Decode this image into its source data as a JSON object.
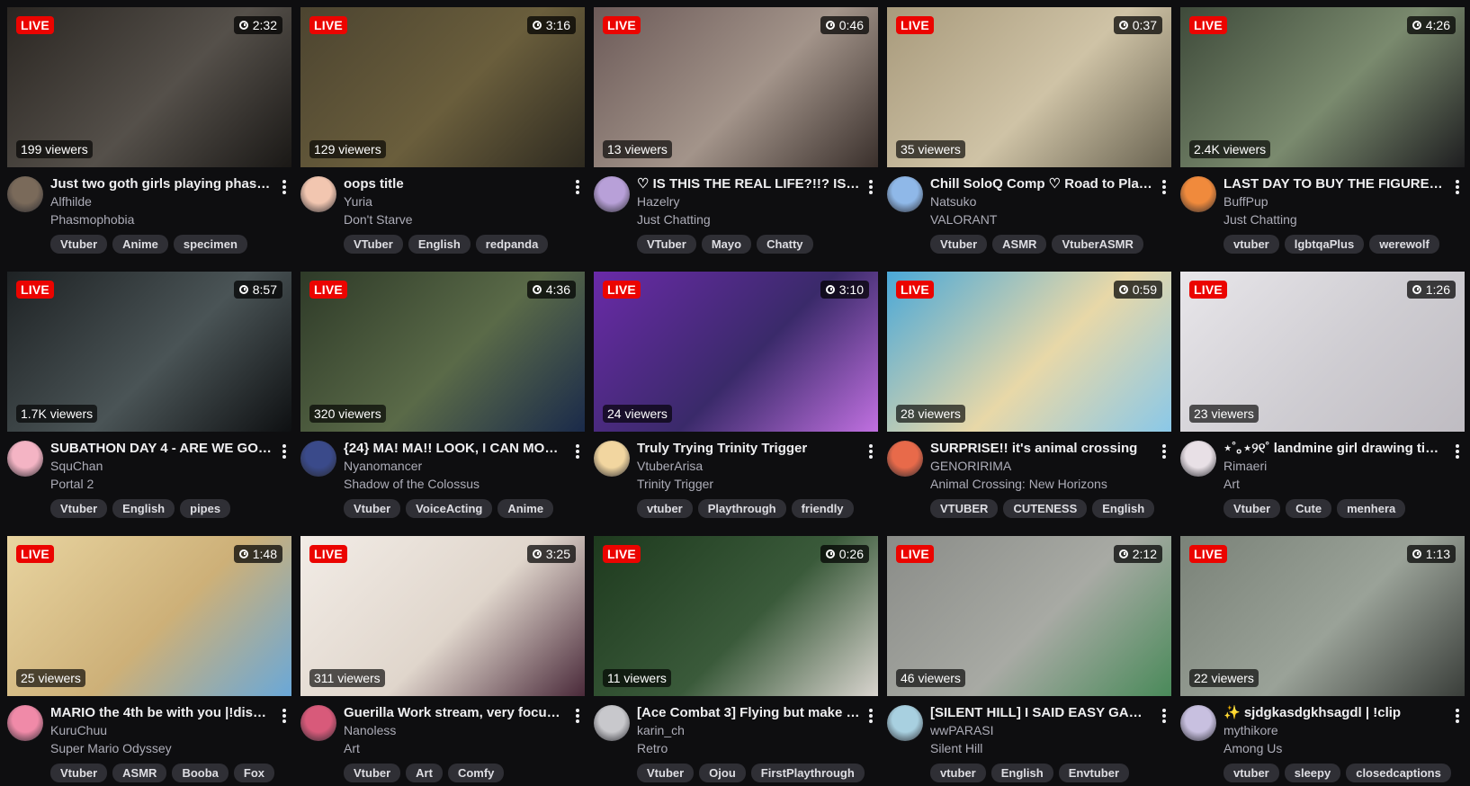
{
  "live_label": "LIVE",
  "streams": [
    {
      "uptime": "2:32",
      "viewers": "199 viewers",
      "title": "Just two goth girls playing phasm...",
      "channel": "Alfhilde",
      "category": "Phasmophobia",
      "tags": [
        "Vtuber",
        "Anime",
        "specimen"
      ],
      "thumb_colors": [
        "#2a2622",
        "#55504a",
        "#1a1816"
      ],
      "avatar_color": "#7a6a5a"
    },
    {
      "uptime": "3:16",
      "viewers": "129 viewers",
      "title": "oops title",
      "channel": "Yuria",
      "category": "Don't Starve",
      "tags": [
        "VTuber",
        "English",
        "redpanda"
      ],
      "thumb_colors": [
        "#4c4430",
        "#6a5e3c",
        "#2e2a20"
      ],
      "avatar_color": "#f2c6b0"
    },
    {
      "uptime": "0:46",
      "viewers": "13 viewers",
      "title": "♡ IS THIS THE REAL LIFE?!!? IS TH...",
      "channel": "Hazelry",
      "category": "Just Chatting",
      "tags": [
        "VTuber",
        "Mayo",
        "Chatty"
      ],
      "thumb_colors": [
        "#6c5a58",
        "#a3948a",
        "#3a302c"
      ],
      "avatar_color": "#b8a0d8"
    },
    {
      "uptime": "0:37",
      "viewers": "35 viewers",
      "title": "Chill SoloQ Comp ♡ Road to Platin...",
      "channel": "Natsuko",
      "category": "VALORANT",
      "tags": [
        "Vtuber",
        "ASMR",
        "VtuberASMR"
      ],
      "thumb_colors": [
        "#a89a7c",
        "#cfc3a6",
        "#6a6452"
      ],
      "avatar_color": "#8fb8e8"
    },
    {
      "uptime": "4:26",
      "viewers": "2.4K viewers",
      "title": "LAST DAY TO BUY THE FIGURE!!! ...",
      "channel": "BuffPup",
      "category": "Just Chatting",
      "tags": [
        "vtuber",
        "lgbtqaPlus",
        "werewolf"
      ],
      "thumb_colors": [
        "#3e4a3a",
        "#7a8a6e",
        "#1e1e20"
      ],
      "avatar_color": "#f08a3c"
    },
    {
      "uptime": "8:57",
      "viewers": "1.7K viewers",
      "title": "SUBATHON DAY 4 - ARE WE GOIN...",
      "channel": "SquChan",
      "category": "Portal 2",
      "tags": [
        "Vtuber",
        "English",
        "pipes"
      ],
      "thumb_colors": [
        "#1e2224",
        "#4a5456",
        "#0e1012"
      ],
      "avatar_color": "#f4b4c4"
    },
    {
      "uptime": "4:36",
      "viewers": "320 viewers",
      "title": "{24} MA! MA!! LOOK, I CAN MOVE...",
      "channel": "Nyanomancer",
      "category": "Shadow of the Colossus",
      "tags": [
        "Vtuber",
        "VoiceActing",
        "Anime"
      ],
      "thumb_colors": [
        "#2e3a28",
        "#5a6a48",
        "#1a2a4a"
      ],
      "avatar_color": "#3a4a8a"
    },
    {
      "uptime": "3:10",
      "viewers": "24 viewers",
      "title": "Truly Trying Trinity Trigger",
      "channel": "VtuberArisa",
      "category": "Trinity Trigger",
      "tags": [
        "vtuber",
        "Playthrough",
        "friendly"
      ],
      "thumb_colors": [
        "#6a2aa8",
        "#3a2a6a",
        "#c070e0"
      ],
      "avatar_color": "#f2d6a0"
    },
    {
      "uptime": "0:59",
      "viewers": "28 viewers",
      "title": "SURPRISE!! it's animal crossing",
      "channel": "GENORIRIMA",
      "category": "Animal Crossing: New Horizons",
      "tags": [
        "VTUBER",
        "CUTENESS",
        "English"
      ],
      "thumb_colors": [
        "#4aa8d8",
        "#e8d8a8",
        "#8ac8e8"
      ],
      "avatar_color": "#e86a4a"
    },
    {
      "uptime": "1:26",
      "viewers": "23 viewers",
      "title": "⋆˚｡⋆୨୧˚ landmine girl drawing tim...",
      "channel": "Rimaeri",
      "category": "Art",
      "tags": [
        "Vtuber",
        "Cute",
        "menhera"
      ],
      "thumb_colors": [
        "#e8e6ea",
        "#cfcdd2",
        "#bfbcc2"
      ],
      "avatar_color": "#e8e0e6"
    },
    {
      "uptime": "1:48",
      "viewers": "25 viewers",
      "title": "MARIO the 4th be with you |!disco...",
      "channel": "KuruChuu",
      "category": "Super Mario Odyssey",
      "tags": [
        "Vtuber",
        "ASMR",
        "Booba",
        "Fox"
      ],
      "thumb_colors": [
        "#e8d4a0",
        "#cdb078",
        "#6aa8d8"
      ],
      "avatar_color": "#f08aa8"
    },
    {
      "uptime": "3:25",
      "viewers": "311 viewers",
      "title": "Guerilla Work stream, very focus ...",
      "channel": "Nanoless",
      "category": "Art",
      "tags": [
        "Vtuber",
        "Art",
        "Comfy"
      ],
      "thumb_colors": [
        "#f2ece6",
        "#e0d6cc",
        "#4a2a3a"
      ],
      "avatar_color": "#d85a7a"
    },
    {
      "uptime": "0:26",
      "viewers": "11 viewers",
      "title": "[Ace Combat 3] Flying but make it...",
      "channel": "karin_ch",
      "category": "Retro",
      "tags": [
        "Vtuber",
        "Ojou",
        "FirstPlaythrough"
      ],
      "thumb_colors": [
        "#1e3a1e",
        "#3a5a3a",
        "#d8d4ce"
      ],
      "avatar_color": "#c8c8cc"
    },
    {
      "uptime": "2:12",
      "viewers": "46 viewers",
      "title": "[SILENT HILL] I SAID EASY GAME ...",
      "channel": "wwPARASI",
      "category": "Silent Hill",
      "tags": [
        "vtuber",
        "English",
        "Envtuber"
      ],
      "thumb_colors": [
        "#8a8c88",
        "#a8aaa4",
        "#4a8a5a"
      ],
      "avatar_color": "#a8d0e0"
    },
    {
      "uptime": "1:13",
      "viewers": "22 viewers",
      "title": "✨ sjdgkasdgkhsagdl | !clip",
      "channel": "mythikore",
      "category": "Among Us",
      "tags": [
        "vtuber",
        "sleepy",
        "closedcaptions"
      ],
      "thumb_colors": [
        "#7a8278",
        "#9aa298",
        "#3a3e3a"
      ],
      "avatar_color": "#c8c0e0"
    }
  ]
}
